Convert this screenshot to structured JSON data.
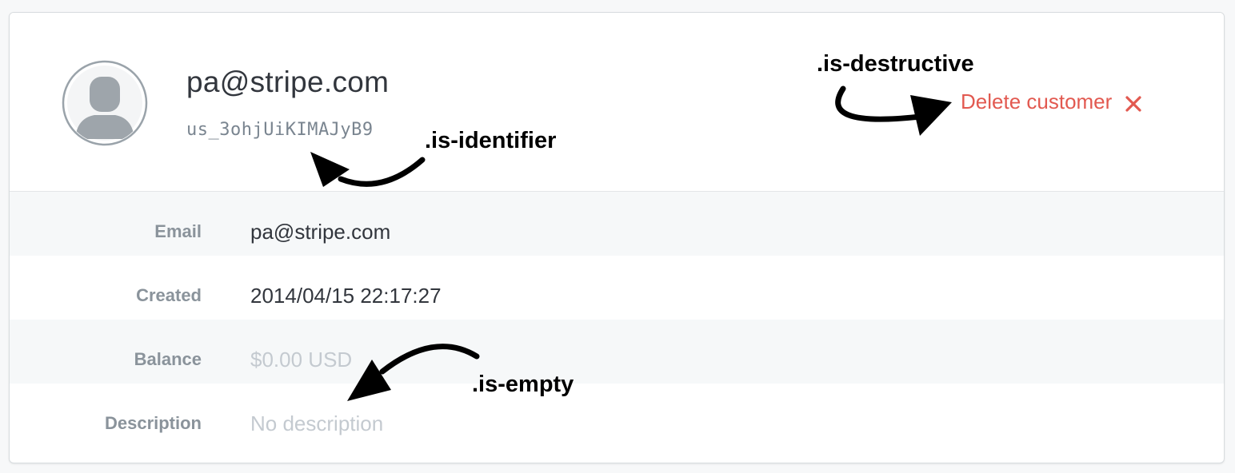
{
  "customer": {
    "title": "pa@stripe.com",
    "identifier": "us_3ohjUiKIMAJyB9"
  },
  "actions": {
    "delete_label": "Delete customer",
    "delete_icon": "close-icon",
    "destructive_color": "#e25950"
  },
  "details": [
    {
      "label": "Email",
      "value": "pa@stripe.com",
      "empty": false
    },
    {
      "label": "Created",
      "value": "2014/04/15 22:17:27",
      "empty": false
    },
    {
      "label": "Balance",
      "value": "$0.00 USD",
      "empty": true
    },
    {
      "label": "Description",
      "value": "No description",
      "empty": true
    }
  ],
  "annotations": {
    "destructive": ".is-destructive",
    "identifier": ".is-identifier",
    "empty": ".is-empty"
  }
}
